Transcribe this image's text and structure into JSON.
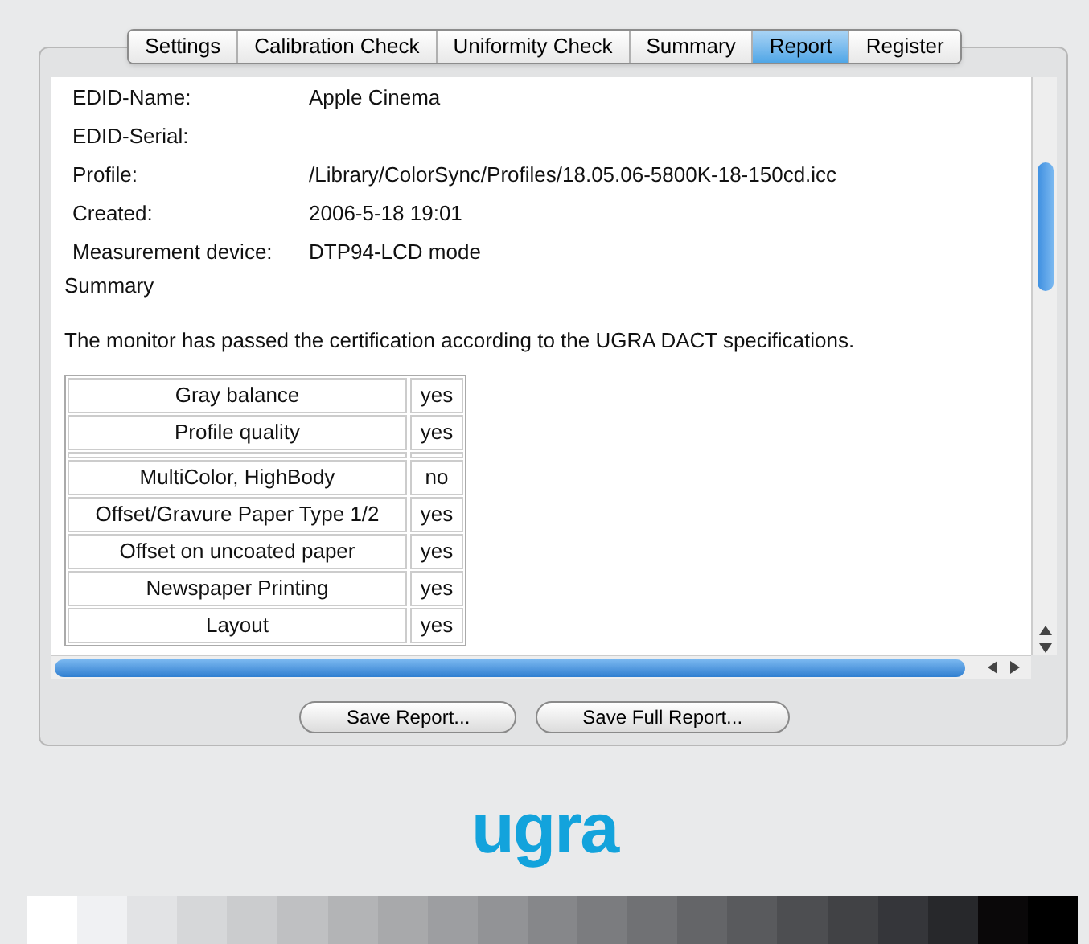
{
  "tabs": [
    {
      "label": "Settings",
      "selected": false
    },
    {
      "label": "Calibration Check",
      "selected": false
    },
    {
      "label": "Uniformity Check",
      "selected": false
    },
    {
      "label": "Summary",
      "selected": false
    },
    {
      "label": "Report",
      "selected": true
    },
    {
      "label": "Register",
      "selected": false
    }
  ],
  "report": {
    "fields": [
      {
        "label": "EDID-Name:",
        "value": "Apple Cinema"
      },
      {
        "label": "EDID-Serial:"
      },
      {
        "label": "Profile:",
        "value": "/Library/ColorSync/Profiles/18.05.06-5800K-18-150cd.icc"
      },
      {
        "label": "Created:",
        "value": "2006-5-18 19:01"
      },
      {
        "label": "Measurement device:",
        "value": "DTP94-LCD mode"
      }
    ],
    "heading": "Summary",
    "statement": "The monitor has passed the certification according to the UGRA DACT specifications.",
    "rows": [
      {
        "kind": "result",
        "name": "Gray balance",
        "result": "yes"
      },
      {
        "kind": "result",
        "name": "Profile quality",
        "result": "yes"
      },
      {
        "kind": "spacer"
      },
      {
        "kind": "result",
        "name": "MultiColor, HighBody",
        "result": "no"
      },
      {
        "kind": "result",
        "name": "Offset/Gravure Paper Type 1/2",
        "result": "yes"
      },
      {
        "kind": "result",
        "name": "Offset on uncoated paper",
        "result": "yes"
      },
      {
        "kind": "result",
        "name": "Newspaper Printing",
        "result": "yes"
      },
      {
        "kind": "result",
        "name": "Layout",
        "result": "yes"
      }
    ]
  },
  "buttons": [
    "Save Report...",
    "Save Full Report..."
  ],
  "logo": "ugra"
}
